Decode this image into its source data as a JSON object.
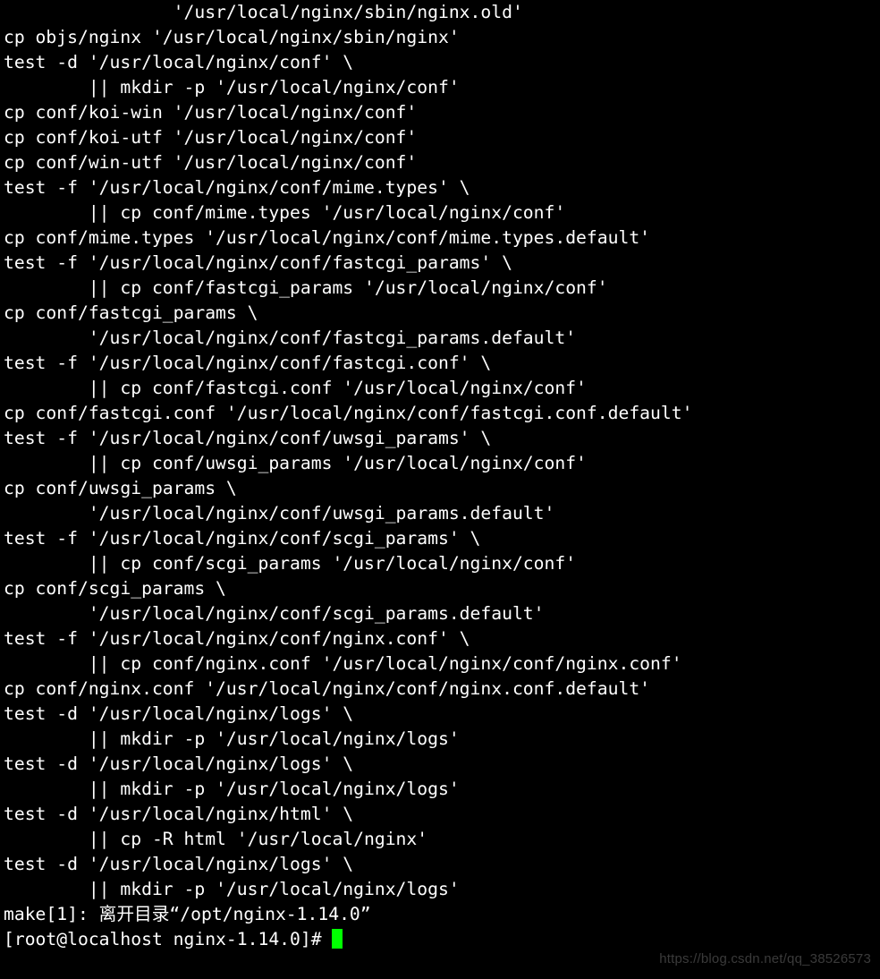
{
  "terminal": {
    "lines": [
      "                '/usr/local/nginx/sbin/nginx.old'",
      "cp objs/nginx '/usr/local/nginx/sbin/nginx'",
      "test -d '/usr/local/nginx/conf' \\",
      "        || mkdir -p '/usr/local/nginx/conf'",
      "cp conf/koi-win '/usr/local/nginx/conf'",
      "cp conf/koi-utf '/usr/local/nginx/conf'",
      "cp conf/win-utf '/usr/local/nginx/conf'",
      "test -f '/usr/local/nginx/conf/mime.types' \\",
      "        || cp conf/mime.types '/usr/local/nginx/conf'",
      "cp conf/mime.types '/usr/local/nginx/conf/mime.types.default'",
      "test -f '/usr/local/nginx/conf/fastcgi_params' \\",
      "        || cp conf/fastcgi_params '/usr/local/nginx/conf'",
      "cp conf/fastcgi_params \\",
      "        '/usr/local/nginx/conf/fastcgi_params.default'",
      "test -f '/usr/local/nginx/conf/fastcgi.conf' \\",
      "        || cp conf/fastcgi.conf '/usr/local/nginx/conf'",
      "cp conf/fastcgi.conf '/usr/local/nginx/conf/fastcgi.conf.default'",
      "test -f '/usr/local/nginx/conf/uwsgi_params' \\",
      "        || cp conf/uwsgi_params '/usr/local/nginx/conf'",
      "cp conf/uwsgi_params \\",
      "        '/usr/local/nginx/conf/uwsgi_params.default'",
      "test -f '/usr/local/nginx/conf/scgi_params' \\",
      "        || cp conf/scgi_params '/usr/local/nginx/conf'",
      "cp conf/scgi_params \\",
      "        '/usr/local/nginx/conf/scgi_params.default'",
      "test -f '/usr/local/nginx/conf/nginx.conf' \\",
      "        || cp conf/nginx.conf '/usr/local/nginx/conf/nginx.conf'",
      "cp conf/nginx.conf '/usr/local/nginx/conf/nginx.conf.default'",
      "test -d '/usr/local/nginx/logs' \\",
      "        || mkdir -p '/usr/local/nginx/logs'",
      "test -d '/usr/local/nginx/logs' \\",
      "        || mkdir -p '/usr/local/nginx/logs'",
      "test -d '/usr/local/nginx/html' \\",
      "        || cp -R html '/usr/local/nginx'",
      "test -d '/usr/local/nginx/logs' \\",
      "        || mkdir -p '/usr/local/nginx/logs'",
      "make[1]: 离开目录“/opt/nginx-1.14.0”"
    ],
    "prompt": "[root@localhost nginx-1.14.0]# "
  },
  "watermark": "https://blog.csdn.net/qq_38526573"
}
